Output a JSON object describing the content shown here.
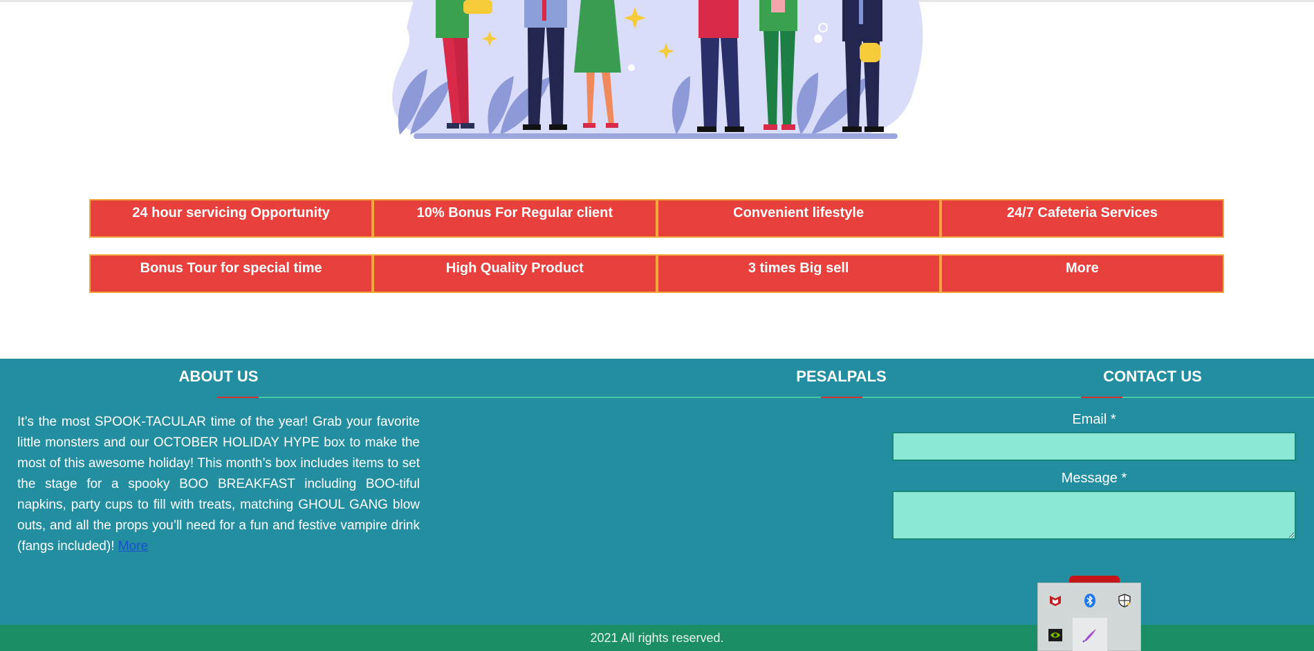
{
  "features": {
    "row1": [
      "24 hour servicing Opportunity",
      "10% Bonus For Regular client",
      "Convenient lifestyle",
      "24/7 Cafeteria Services"
    ],
    "row2": [
      "Bonus Tour for special time",
      "High Quality Product",
      "3 times Big sell",
      "More"
    ]
  },
  "footer": {
    "about_title": "ABOUT US",
    "pal_title": "PESALPALS",
    "contact_title": "CONTACT US",
    "about_text": "It’s the most SPOOK-TACULAR time of the year! Grab your favorite little monsters and our OCTOBER HOLIDAY HYPE box to make the most of this awesome holiday! This month’s box includes items to set the stage for a spooky BOO BREAKFAST including BOO-tiful napkins, party cups to fill with treats, matching GHOUL GANG blow outs, and all the props you’ll need for a fun and festive vampire drink (fangs included)!",
    "about_more_link": "More",
    "email_label": "Email *",
    "message_label": "Message *",
    "copyright": "2021 All rights reserved."
  },
  "tray": {
    "icons": [
      "mcafee-icon",
      "bluetooth-icon",
      "security-shield-icon",
      "nvidia-icon",
      "pen-icon"
    ]
  },
  "colors": {
    "feature_bg": "#e8403c",
    "feature_border": "#f2a83a",
    "footer_bg": "#228ea0",
    "copyright_bg": "#1b8e66",
    "input_bg": "#8ae8d4"
  }
}
